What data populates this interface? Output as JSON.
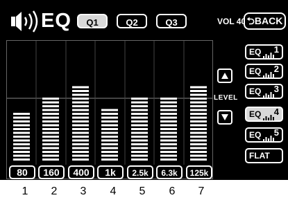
{
  "header": {
    "title": "EQ",
    "user_eq_buttons": [
      {
        "label": "Q1",
        "selected": true
      },
      {
        "label": "Q2",
        "selected": false
      },
      {
        "label": "Q3",
        "selected": false
      }
    ],
    "volume": "VOL 40",
    "back_label": "⮌BACK"
  },
  "equalizer": {
    "max_segments": 20,
    "bands": [
      {
        "freq": "80",
        "level_segments": 13
      },
      {
        "freq": "160",
        "level_segments": 17
      },
      {
        "freq": "400",
        "level_segments": 20
      },
      {
        "freq": "1k",
        "level_segments": 14
      },
      {
        "freq": "2.5k",
        "level_segments": 17
      },
      {
        "freq": "6.3k",
        "level_segments": 17
      },
      {
        "freq": "125k",
        "level_segments": 20
      }
    ]
  },
  "level_control": {
    "label": "LEVEL",
    "up_icon": "triangle-up-icon",
    "down_icon": "triangle-down-icon"
  },
  "presets": [
    {
      "label": "EQ",
      "number": "1",
      "selected": false
    },
    {
      "label": "EQ",
      "number": "2",
      "selected": false
    },
    {
      "label": "EQ",
      "number": "3",
      "selected": false
    },
    {
      "label": "EQ",
      "number": "4",
      "selected": true
    },
    {
      "label": "EQ",
      "number": "5",
      "selected": false
    },
    {
      "label": "FLAT",
      "number": "",
      "selected": false
    }
  ],
  "band_numbers": [
    "1",
    "2",
    "3",
    "4",
    "5",
    "6",
    "7"
  ],
  "colors": {
    "background": "#000000",
    "foreground": "#ffffff",
    "selected": "#d8d8d8"
  }
}
